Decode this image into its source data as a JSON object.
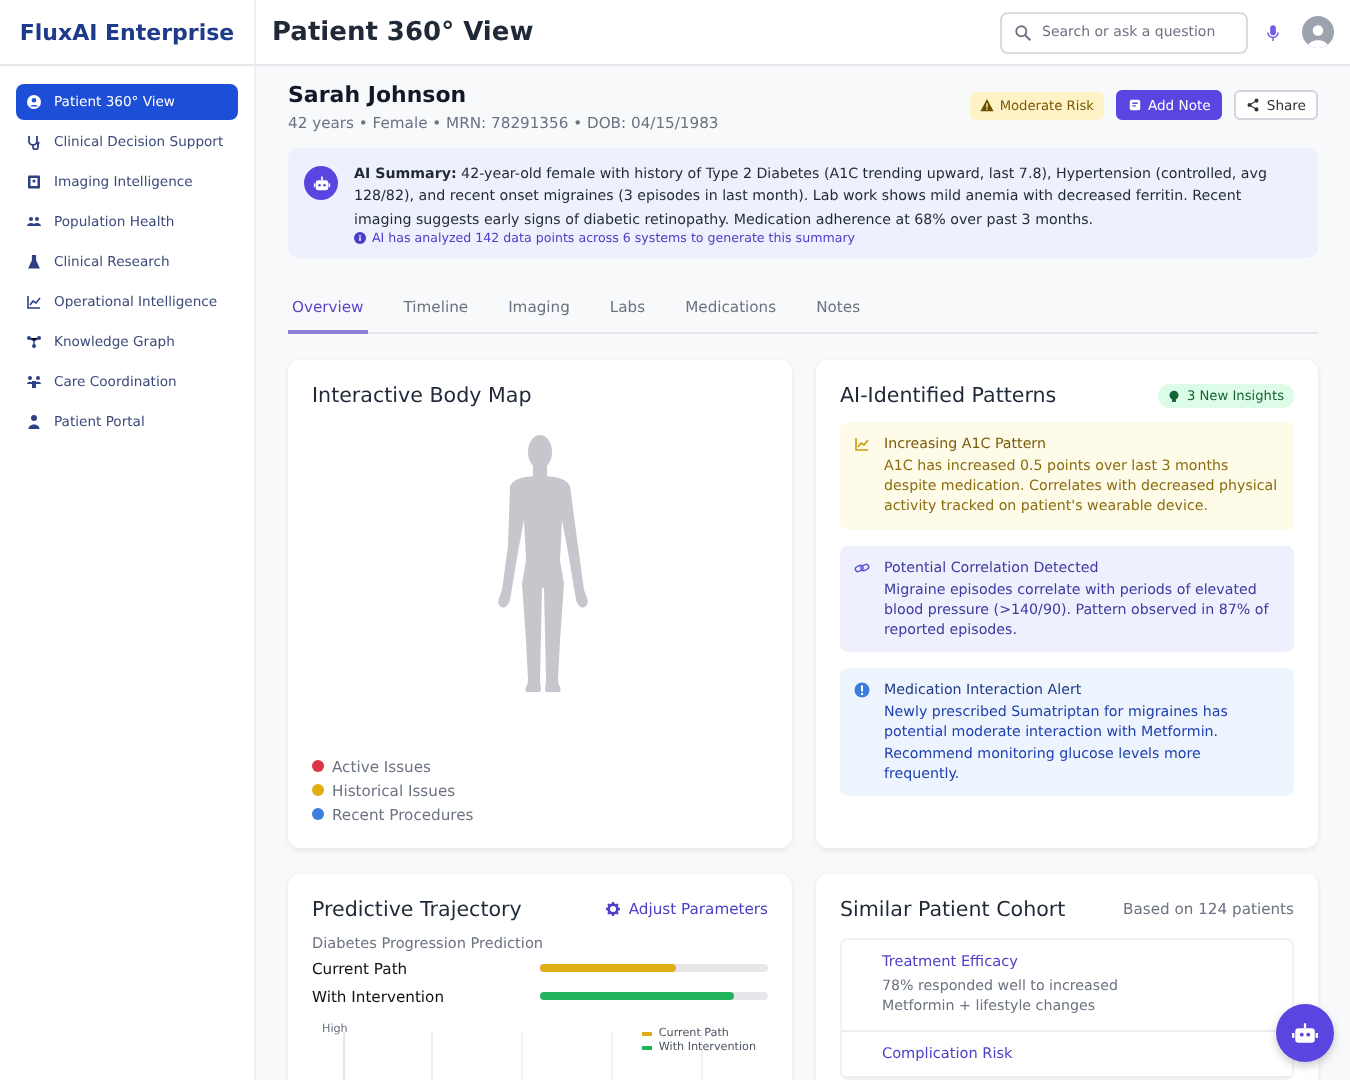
{
  "app": {
    "name": "FluxAI Enterprise"
  },
  "header": {
    "title": "Patient 360° View",
    "search": {
      "placeholder": "Search or ask a question"
    }
  },
  "sidebar": {
    "items": [
      {
        "label": "Patient 360° View",
        "selected": true
      },
      {
        "label": "Clinical Decision Support",
        "selected": false
      },
      {
        "label": "Imaging Intelligence",
        "selected": false
      },
      {
        "label": "Population Health",
        "selected": false
      },
      {
        "label": "Clinical Research",
        "selected": false
      },
      {
        "label": "Operational Intelligence",
        "selected": false
      },
      {
        "label": "Knowledge Graph",
        "selected": false
      },
      {
        "label": "Care Coordination",
        "selected": false
      },
      {
        "label": "Patient Portal",
        "selected": false
      }
    ]
  },
  "patient": {
    "name": "Sarah Johnson",
    "details": "42 years • Female • MRN: 78291356 • DOB: 04/15/1983",
    "risk_badge": "Moderate Risk",
    "actions": [
      {
        "label": "Add Note",
        "kind": "primary"
      },
      {
        "label": "Share",
        "kind": "secondary"
      }
    ]
  },
  "ai_summary": {
    "text": "**AI Summary:** 42-year-old female with history of Type 2 Diabetes (A1C trending upward, last 7.8), Hypertension (controlled, avg 128/82), and recent onset migraines (3 episodes in last month). Lab work shows mild anemia with decreased ferritin. Recent imaging suggests early signs of diabetic retinopathy. Medication adherence at 68% over past 3 months.",
    "footnote": "AI has analyzed 142 data points across 6 systems to generate this summary"
  },
  "tabs": [
    {
      "label": "Overview",
      "selected": true
    },
    {
      "label": "Timeline",
      "selected": false
    },
    {
      "label": "Imaging",
      "selected": false
    },
    {
      "label": "Labs",
      "selected": false
    },
    {
      "label": "Medications",
      "selected": false
    },
    {
      "label": "Notes",
      "selected": false
    }
  ],
  "body_map": {
    "title": "Interactive Body Map",
    "legend": [
      {
        "label": "Active Issues",
        "color": "#dc3545"
      },
      {
        "label": "Historical Issues",
        "color": "#e0ad12"
      },
      {
        "label": "Recent Procedures",
        "color": "#3b7ddd"
      }
    ]
  },
  "patterns": {
    "title": "AI-Identified Patterns",
    "badge": "3 New Insights",
    "items": [
      {
        "kind": "trend",
        "title": "Increasing A1C Pattern",
        "text": "A1C has increased 0.5 points over last 3 months despite medication. Correlates with decreased physical activity tracked on patient's wearable device."
      },
      {
        "kind": "correlation",
        "title": "Potential Correlation Detected",
        "text": "Migraine episodes correlate with periods of elevated blood pressure (>140/90). Pattern observed in 87% of reported episodes."
      },
      {
        "kind": "alert",
        "title": "Medication Interaction Alert",
        "text": "Newly prescribed Sumatriptan for migraines has potential moderate interaction with Metformin. Recommend monitoring glucose levels more frequently."
      }
    ]
  },
  "trajectory": {
    "title": "Predictive Trajectory",
    "action": "Adjust Parameters",
    "subtitle": "Diabetes Progression Prediction",
    "paths": [
      {
        "label": "Current Path",
        "level": 0.6,
        "color": "#e0ad12"
      },
      {
        "label": "With Intervention",
        "level": 0.85,
        "color": "#22b35e"
      }
    ],
    "chart": {
      "y_label": "High",
      "legend": [
        {
          "label": "Current Path",
          "color": "#e0ad12"
        },
        {
          "label": "With Intervention",
          "color": "#22b35e"
        }
      ]
    }
  },
  "cohort": {
    "title": "Similar Patient Cohort",
    "note": "Based on 124 patients",
    "items": [
      {
        "title": "Treatment Efficacy",
        "text": "78% responded well to increased Metformin + lifestyle changes"
      },
      {
        "title": "Complication Risk"
      }
    ]
  }
}
